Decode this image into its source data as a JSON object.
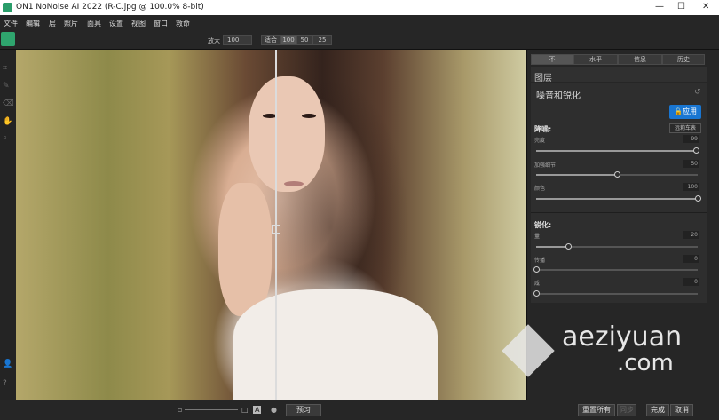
{
  "window": {
    "title": "ON1 NoNoise AI 2022 (R-C.jpg @ 100.0% 8-bit)",
    "minimize": "—",
    "maximize": "☐",
    "close": "✕"
  },
  "menu": [
    "文件",
    "编辑",
    "层",
    "照片",
    "面具",
    "设置",
    "视图",
    "窗口",
    "救命"
  ],
  "toolbar": {
    "zoom_label": "放大",
    "zoom_value": "100",
    "compare": [
      "适合",
      "100",
      "50",
      "25"
    ]
  },
  "right_tabs": [
    "不",
    "水平",
    "信息",
    "历史"
  ],
  "layers_header": "图层",
  "module": {
    "title": "噪音和锐化",
    "apply_label": "应用",
    "noise_group": "降噪:",
    "preset": "远莉车表",
    "noise_sliders": [
      {
        "label": "亮度",
        "value": "99",
        "fraction": 0.99
      },
      {
        "label": "加强细节",
        "value": "50",
        "fraction": 0.5
      },
      {
        "label": "颜色",
        "value": "100",
        "fraction": 1.0
      }
    ],
    "sharpen_group": "锐化:",
    "sharpen_sliders": [
      {
        "label": "量",
        "value": "20",
        "fraction": 0.2
      },
      {
        "label": "传播",
        "value": "0",
        "fraction": 0.0
      },
      {
        "label": "咸",
        "value": "0",
        "fraction": 0.0
      }
    ]
  },
  "bottom": {
    "preview_label": "预习",
    "reset_all": "重置所有",
    "sync": "同步",
    "done": "完成",
    "cancel": "取消"
  },
  "watermark": {
    "name": "aeziyuan",
    "domain": ".com"
  }
}
